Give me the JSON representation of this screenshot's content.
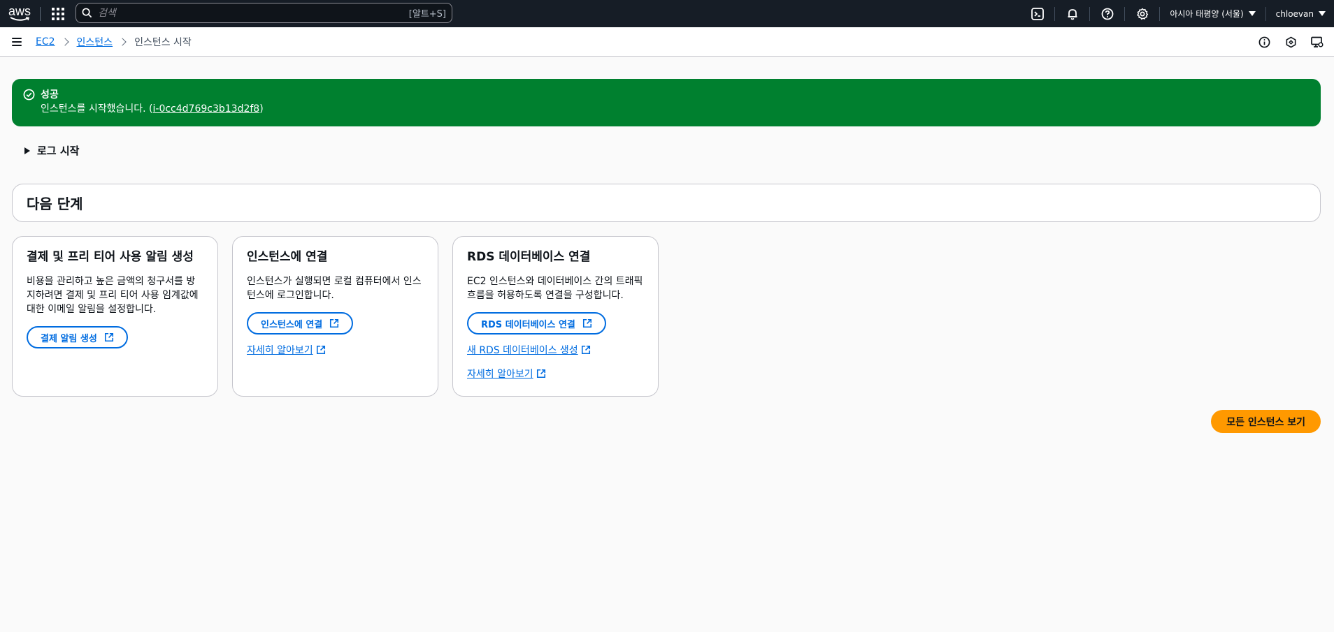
{
  "topnav": {
    "logo": "aws",
    "search_placeholder": "검색",
    "search_shortcut": "[알트+S]",
    "region": "아시아 태평양 (서울)",
    "user": "chloevan",
    "icons": [
      "cloudshell-icon",
      "bell-icon",
      "help-icon",
      "gear-icon"
    ]
  },
  "breadcrumbs": {
    "items": [
      "EC2",
      "인스턴스"
    ],
    "current": "인스턴스 시작"
  },
  "flash": {
    "type": "success",
    "color": "#00802f",
    "title": "성공",
    "message_prefix": "인스턴스를 시작했습니다. (",
    "instance_id": "i-0cc4d769c3b13d2f8",
    "message_suffix": ")"
  },
  "launch_log": {
    "label": "로그 시작"
  },
  "next_steps": {
    "title": "다음 단계",
    "cards": [
      {
        "title": "결제 및 프리 티어 사용 알림 생성",
        "description": "비용을 관리하고 높은 금액의 청구서를 방지하려면 결제 및 프리 티어 사용 임계값에 대한 이메일 알림을 설정합니다.",
        "button": "결제 알림 생성"
      },
      {
        "title": "인스턴스에 연결",
        "description": "인스턴스가 실행되면 로컬 컴퓨터에서 인스턴스에 로그인합니다.",
        "button": "인스턴스에 연결",
        "links": [
          "자세히 알아보기"
        ]
      },
      {
        "title": "RDS 데이터베이스 연결",
        "description": "EC2 인스턴스와 데이터베이스 간의 트래픽 흐름을 허용하도록 연결을 구성합니다.",
        "button": "RDS 데이터베이스 연결",
        "links": [
          "새 RDS 데이터베이스 생성",
          "자세히 알아보기"
        ]
      }
    ]
  },
  "primary_action": {
    "label": "모든 인스턴스 보기",
    "color": "#ff9900"
  }
}
